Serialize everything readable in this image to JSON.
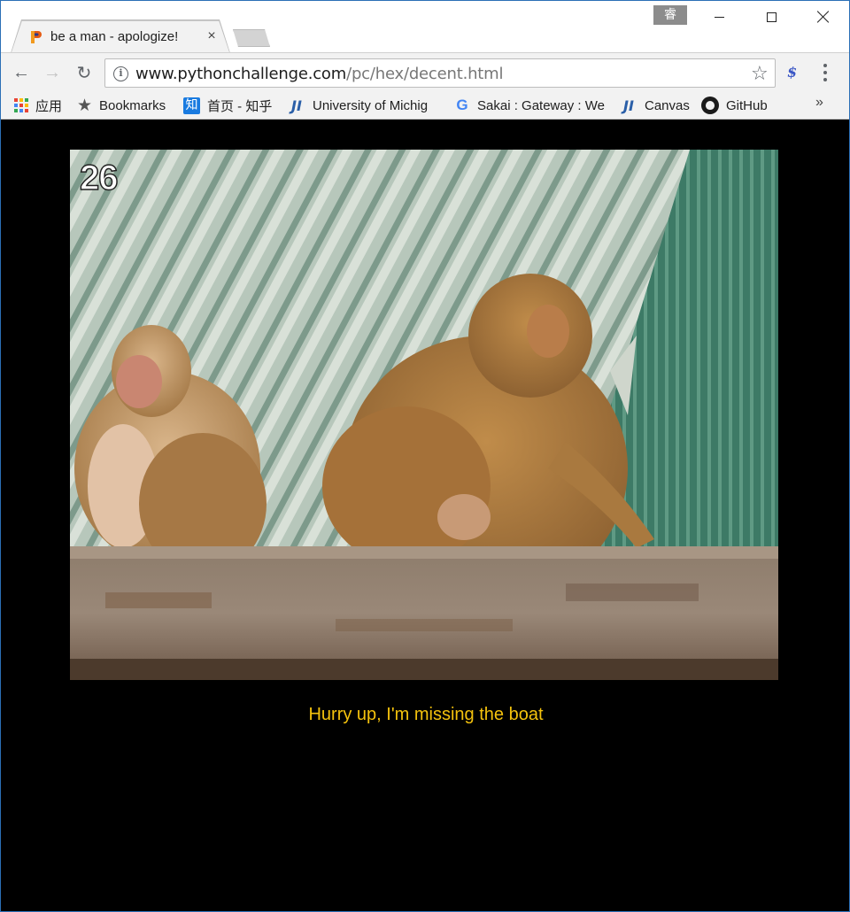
{
  "tab": {
    "title": "be a man - apologize!",
    "close_glyph": "×",
    "favicon": "python-challenge-favicon"
  },
  "window": {
    "ime_badge": "睿",
    "controls": [
      "minimize",
      "maximize",
      "close"
    ]
  },
  "toolbar": {
    "back_glyph": "←",
    "forward_glyph": "→",
    "reload_glyph": "↻",
    "url_host": "www.pythonchallenge.com",
    "url_path": "/pc/hex/decent.html",
    "info_glyph": "i",
    "star_glyph": "☆",
    "extension_glyph": "$"
  },
  "bookmarks": {
    "items": [
      {
        "label": "应用",
        "icon": "apps-grid-icon"
      },
      {
        "label": "Bookmarks",
        "icon": "star-icon",
        "glyph": "★"
      },
      {
        "label": "首页 - 知乎",
        "icon": "zhihu-icon",
        "glyph": "知"
      },
      {
        "label": "University of Michig",
        "icon": "ji-icon",
        "glyph": "JI"
      },
      {
        "label": "Sakai : Gateway : We",
        "icon": "google-icon",
        "glyph": "G"
      },
      {
        "label": "Canvas",
        "icon": "ji-icon",
        "glyph": "JI"
      },
      {
        "label": "GitHub",
        "icon": "github-icon"
      }
    ],
    "overflow_glyph": "»"
  },
  "page": {
    "frame_number": "26",
    "caption": "Hurry up, I'm missing the boat"
  },
  "colors": {
    "page_background": "#000000",
    "caption": "#f4c20d",
    "window_border": "#2b6fb6",
    "toolbar": "#f2f2f2"
  }
}
